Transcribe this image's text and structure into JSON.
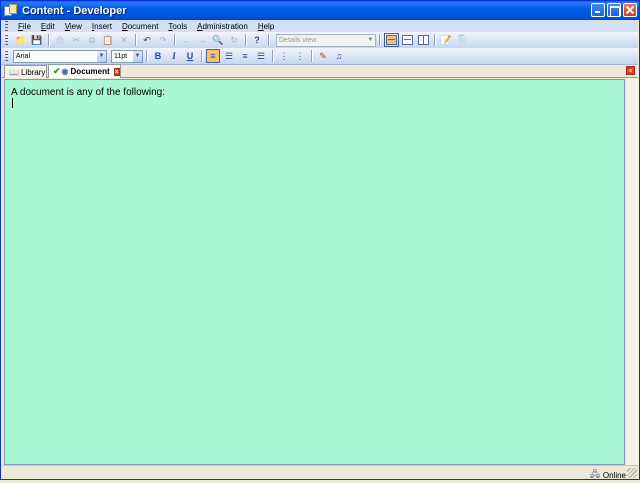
{
  "window": {
    "title": "Content - Developer"
  },
  "menu": {
    "items": [
      {
        "first": "F",
        "rest": "ile"
      },
      {
        "first": "E",
        "rest": "dit"
      },
      {
        "first": "V",
        "rest": "iew"
      },
      {
        "first": "I",
        "rest": "nsert"
      },
      {
        "first": "D",
        "rest": "ocument"
      },
      {
        "first": "T",
        "rest": "ools"
      },
      {
        "first": "A",
        "rest": "dministration"
      },
      {
        "first": "H",
        "rest": "elp"
      }
    ]
  },
  "toolbar": {
    "view_select": "Details view",
    "font": "Arial",
    "font_size": "11pt",
    "bold": "B",
    "italic": "I",
    "underline": "U",
    "help": "?"
  },
  "tabs": [
    {
      "label": "Library"
    },
    {
      "label": "Document",
      "active": true
    }
  ],
  "document": {
    "text": "A document is any of the following:"
  },
  "status": {
    "connection": "Online"
  },
  "colors": {
    "document_background": "#aaf7d4",
    "title_bar": "#0058e6",
    "accent_active": "#f7c268"
  }
}
